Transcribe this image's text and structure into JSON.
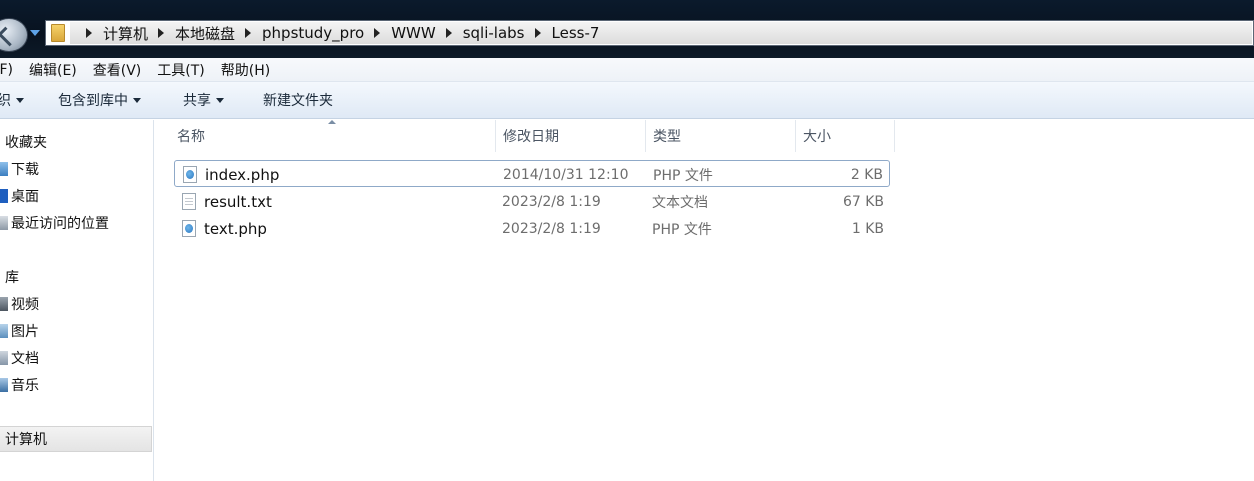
{
  "address": {
    "path": [
      "计算机",
      "本地磁盘",
      "phpstudy_pro",
      "WWW",
      "sqli-labs",
      "Less-7"
    ]
  },
  "menu": [
    "(F)",
    "编辑(E)",
    "查看(V)",
    "工具(T)",
    "帮助(H)"
  ],
  "toolbar": {
    "organize": "织",
    "include_in_library": "包含到库中",
    "share": "共享",
    "new_folder": "新建文件夹"
  },
  "sidebar": {
    "favorites_header": "收藏夹",
    "favorites": [
      "下载",
      "桌面",
      "最近访问的位置"
    ],
    "libraries_header": "库",
    "libraries": [
      "视频",
      "图片",
      "文档",
      "音乐"
    ],
    "computer": "计算机"
  },
  "columns": {
    "name": "名称",
    "date": "修改日期",
    "type": "类型",
    "size": "大小"
  },
  "files": [
    {
      "name": "index.php",
      "date": "2014/10/31 12:10",
      "type": "PHP 文件",
      "size": "2 KB",
      "icon": "php-file-icon"
    },
    {
      "name": "result.txt",
      "date": "2023/2/8 1:19",
      "type": "文本文档",
      "size": "67 KB",
      "icon": "text-file-icon"
    },
    {
      "name": "text.php",
      "date": "2023/2/8 1:19",
      "type": "PHP 文件",
      "size": "1 KB",
      "icon": "php-file-icon"
    }
  ]
}
